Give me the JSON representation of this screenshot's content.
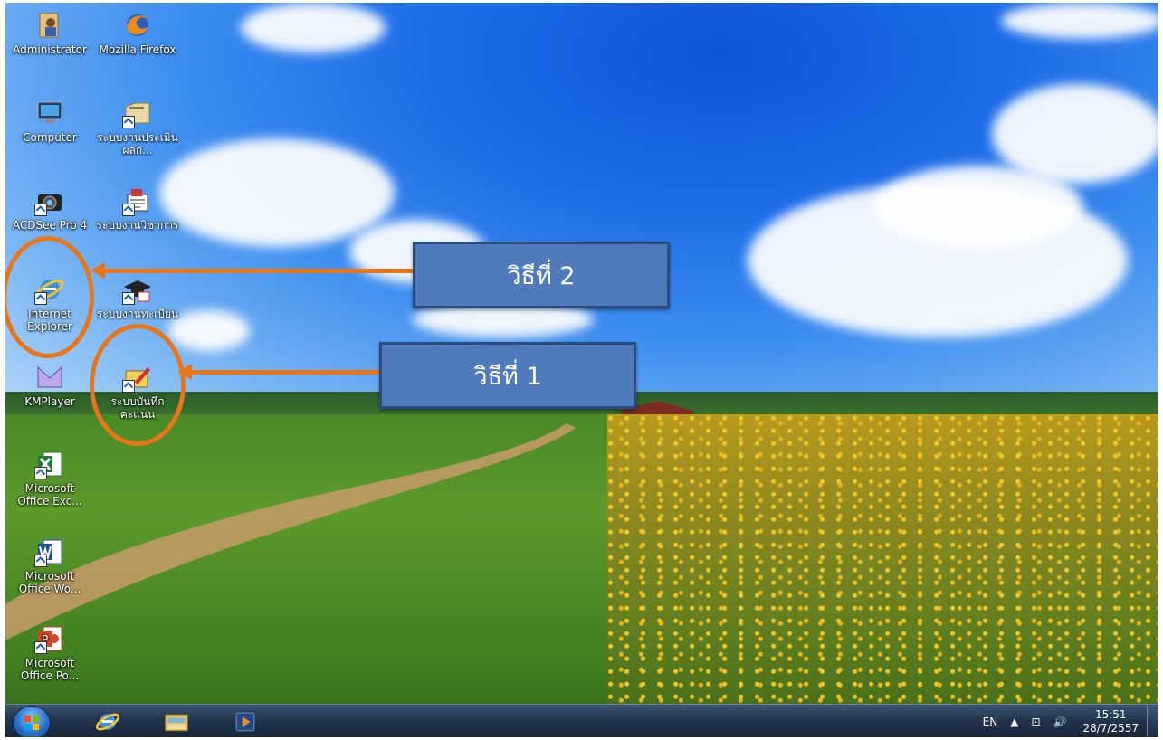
{
  "desktop": {
    "icons": [
      {
        "label": "Administrator",
        "icon": "user-folder-icon"
      },
      {
        "label": "Mozilla Firefox",
        "icon": "firefox-icon"
      },
      {
        "label": "Computer",
        "icon": "computer-icon"
      },
      {
        "label": "ระบบงานประเมินผลก...",
        "icon": "folder-shortcut-icon"
      },
      {
        "label": "ACDSee Pro 4",
        "icon": "camera-icon"
      },
      {
        "label": "ระบบงานวิชาการ",
        "icon": "app-shortcut-icon"
      },
      {
        "label": "Internet Explorer",
        "icon": "internet-explorer-icon"
      },
      {
        "label": "ระบบงานทะเบียน",
        "icon": "graduation-cap-icon"
      },
      {
        "label": "KMPlayer",
        "icon": "kmplayer-icon"
      },
      {
        "label": "ระบบบันทึกคะแนน",
        "icon": "score-record-icon"
      },
      {
        "label": "Microsoft Office Exc...",
        "icon": "excel-icon"
      },
      {
        "label": "Microsoft Office Wo...",
        "icon": "word-icon"
      },
      {
        "label": "Microsoft Office Po...",
        "icon": "powerpoint-icon"
      }
    ]
  },
  "annotations": {
    "method2": "วิธีที่ 2",
    "method1": "วิธีที่ 1"
  },
  "taskbar": {
    "pinned": [
      "start-button",
      "internet-explorer-icon",
      "file-explorer-icon",
      "media-player-icon"
    ],
    "tray": {
      "language": "EN",
      "time": "15:51",
      "date": "28/7/2557"
    }
  },
  "colors": {
    "annotation_orange": "#e8751a",
    "callout_blue": "#4f7bbd",
    "callout_border": "#2b4c7e"
  }
}
